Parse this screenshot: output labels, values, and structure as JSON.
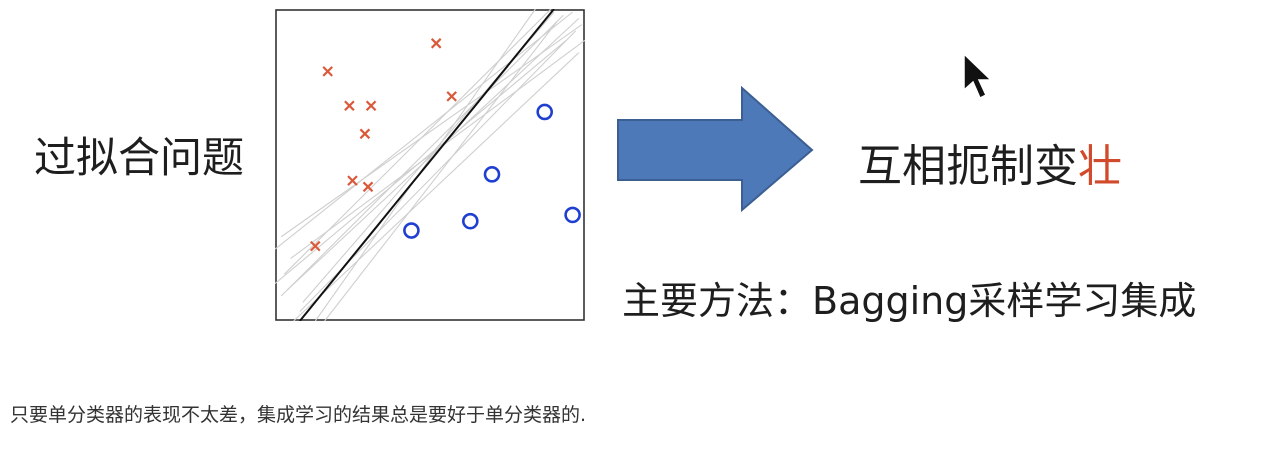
{
  "left_title": "过拟合问题",
  "right_title": {
    "main": "互相扼制变",
    "accent": "壮"
  },
  "method_line": "主要方法：Bagging采样学习集成",
  "caption": "只要单分类器的表现不太差，集成学习的结果总是要好于单分类器的.",
  "icons": {
    "arrow": "right-arrow-icon",
    "cursor": "mouse-cursor-icon"
  },
  "colors": {
    "cross": "#d9593a",
    "circle": "#1f3fd1",
    "boundary": "#111111",
    "ensemble_lines": "#cfcfcf",
    "arrow_fill": "#4e79b8",
    "arrow_stroke": "#3b5f93",
    "accent": "#d04a2b"
  },
  "chart_data": {
    "type": "scatter",
    "title": "",
    "xlabel": "",
    "ylabel": "",
    "xlim": [
      0,
      10
    ],
    "ylim": [
      0,
      10
    ],
    "grid": false,
    "series": [
      {
        "marker": "cross",
        "color": "#d9593a",
        "points": [
          [
            1.7,
            8.0
          ],
          [
            5.2,
            8.9
          ],
          [
            2.4,
            6.9
          ],
          [
            3.1,
            6.9
          ],
          [
            2.9,
            6.0
          ],
          [
            2.5,
            4.5
          ],
          [
            3.0,
            4.3
          ],
          [
            1.3,
            2.4
          ],
          [
            5.7,
            7.2
          ]
        ]
      },
      {
        "marker": "circle",
        "color": "#1f3fd1",
        "points": [
          [
            8.7,
            6.7
          ],
          [
            7.0,
            4.7
          ],
          [
            6.3,
            3.2
          ],
          [
            4.4,
            2.9
          ],
          [
            9.6,
            3.4
          ]
        ]
      }
    ],
    "decision_boundary": [
      [
        0.8,
        0.0
      ],
      [
        9.0,
        10.0
      ]
    ],
    "ensemble_lines": [
      [
        [
          0.3,
          1.5
        ],
        [
          8.9,
          10.0
        ]
      ],
      [
        [
          0.2,
          0.8
        ],
        [
          9.3,
          9.8
        ]
      ],
      [
        [
          0.8,
          0.3
        ],
        [
          9.7,
          9.3
        ]
      ],
      [
        [
          0.0,
          2.3
        ],
        [
          9.6,
          9.9
        ]
      ],
      [
        [
          1.3,
          0.0
        ],
        [
          8.4,
          10.0
        ]
      ],
      [
        [
          0.5,
          2.0
        ],
        [
          10.0,
          9.0
        ]
      ],
      [
        [
          0.6,
          0.0
        ],
        [
          9.8,
          8.6
        ]
      ],
      [
        [
          0.0,
          1.2
        ],
        [
          9.4,
          9.0
        ]
      ],
      [
        [
          1.6,
          0.0
        ],
        [
          9.1,
          9.6
        ]
      ],
      [
        [
          0.2,
          2.7
        ],
        [
          9.9,
          9.5
        ]
      ],
      [
        [
          0.9,
          0.6
        ],
        [
          9.0,
          9.9
        ]
      ],
      [
        [
          0.4,
          1.0
        ],
        [
          9.8,
          9.7
        ]
      ]
    ]
  }
}
